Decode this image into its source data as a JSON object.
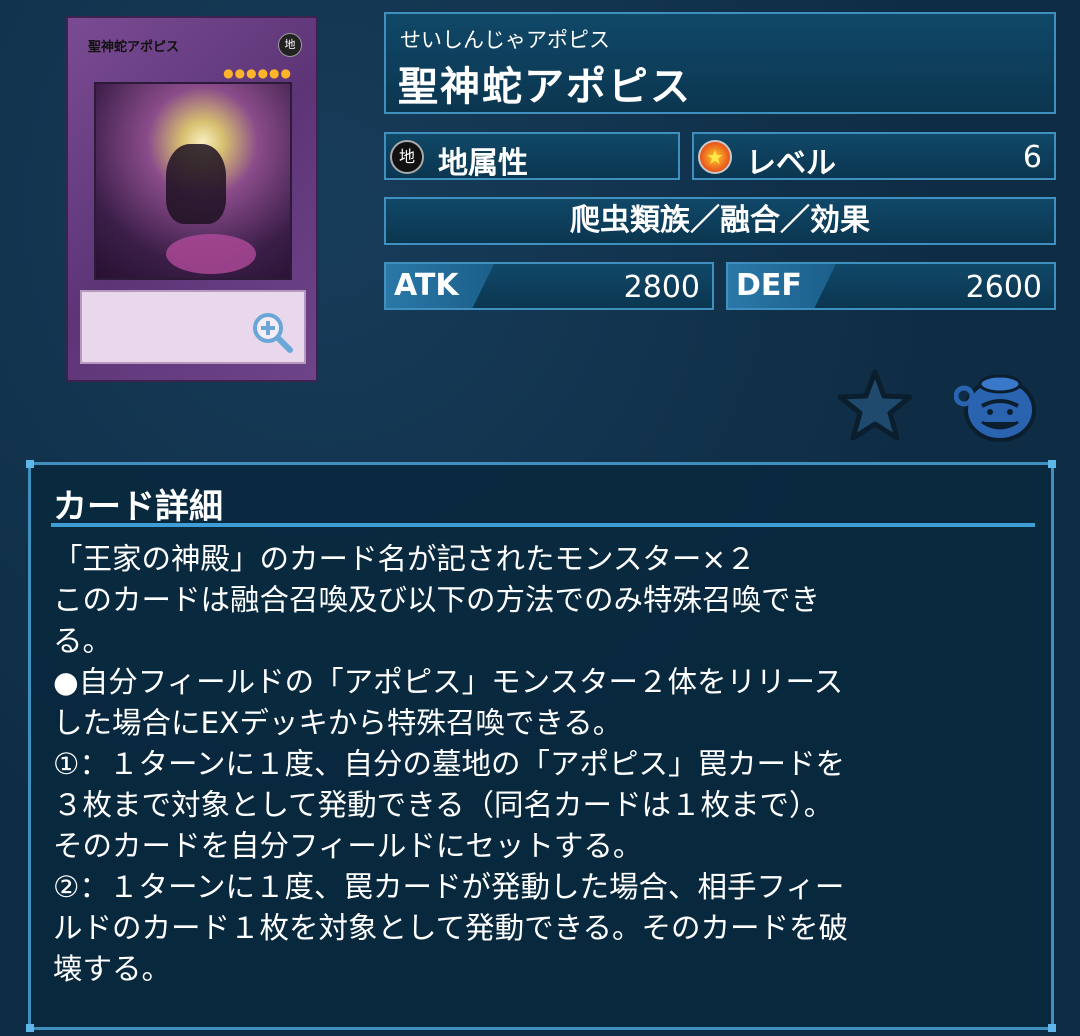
{
  "card_image": {
    "name": "聖神蛇アポピス",
    "attribute_glyph": "地",
    "stars": "●●●●●●",
    "zoom_icon": "zoom-in-icon"
  },
  "card": {
    "furigana": "せいしんじゃアポピス",
    "title": "聖神蛇アポピス",
    "attribute": "地属性",
    "attribute_glyph": "地",
    "level_label": "レベル",
    "level": "6",
    "type_line": "爬虫類族／融合／効果",
    "atk_label": "ATK",
    "atk": "2800",
    "def_label": "DEF",
    "def": "2600"
  },
  "actions": {
    "favorite_icon": "star-icon",
    "deck_icon": "pot-of-greed-icon"
  },
  "detail": {
    "header": "カード詳細",
    "text": "「王家の神殿」のカード名が記されたモンスター×２\nこのカードは融合召喚及び以下の方法でのみ特殊召喚でき\nる。\n●自分フィールドの「アポピス」モンスター２体をリリース\nした場合にEXデッキから特殊召喚できる。\n①：１ターンに１度、自分の墓地の「アポピス」罠カードを\n３枚まで対象として発動できる（同名カードは１枚まで）。\nそのカードを自分フィールドにセットする。\n②：１ターンに１度、罠カードが発動した場合、相手フィー\nルドのカード１枚を対象として発動できる。そのカードを破\n壊する。"
  },
  "colors": {
    "background": "#0e2c44",
    "panel_border": "#3f8fbf",
    "fusion_card": "#6e4489"
  }
}
